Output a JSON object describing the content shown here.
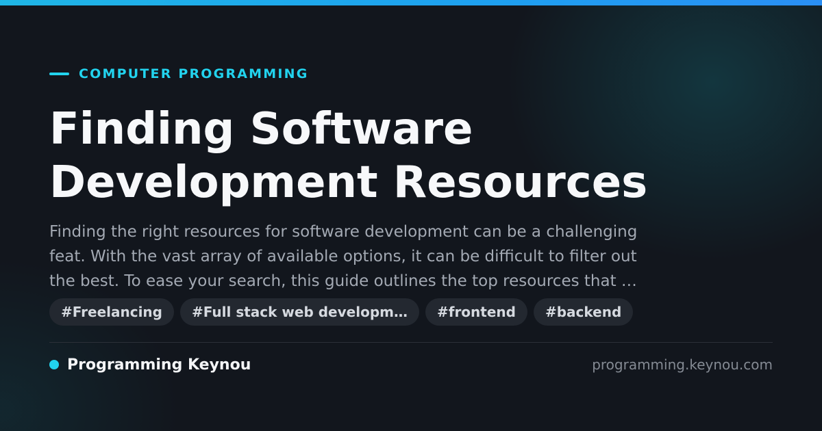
{
  "category": {
    "label": "COMPUTER PROGRAMMING"
  },
  "title": {
    "lines": [
      "Finding Software",
      "Development Resources"
    ]
  },
  "excerpt": {
    "lines": [
      "Finding the right resources for software development can be a challenging",
      "feat. With the vast array of available options, it can be difficult to filter out",
      "the best. To ease your search, this guide outlines the top resources that …"
    ]
  },
  "tags": [
    "#Freelancing",
    "#Full stack web developm…",
    "#frontend",
    "#backend"
  ],
  "footer": {
    "brand": "Programming Keynou",
    "url": "programming.keynou.com"
  },
  "colors": {
    "accent": "#22d3ee",
    "background": "#12161d",
    "tag_background": "#232830"
  }
}
